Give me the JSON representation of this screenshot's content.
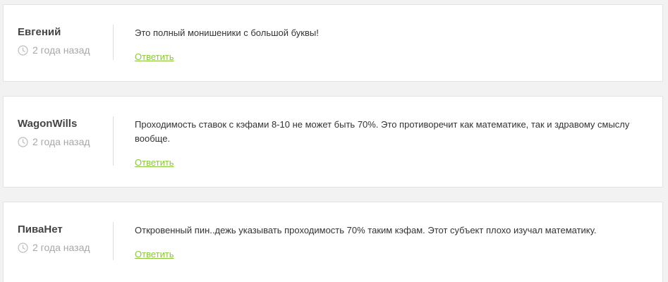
{
  "comments": [
    {
      "author": "Евгений",
      "time": "2 года назад",
      "text": "Это полный монишеники с большой буквы!",
      "reply_label": "Ответить"
    },
    {
      "author": "WagonWills",
      "time": "2 года назад",
      "text": "Проходимость ставок с кэфами 8-10 не может быть 70%. Это противоречит как математике, так и здравому смыслу вообще.",
      "reply_label": "Ответить"
    },
    {
      "author": "ПиваНет",
      "time": "2 года назад",
      "text": "Откровенный пин..дежь указывать проходимость 70% таким кэфам. Этот субъект плохо изучал математику.",
      "reply_label": "Ответить"
    }
  ],
  "icons": {
    "time": "clock-icon"
  },
  "colors": {
    "reply_link": "#8cc63f",
    "author": "#444444",
    "time": "#a8a8a8",
    "page_background": "#f2f2f2"
  }
}
